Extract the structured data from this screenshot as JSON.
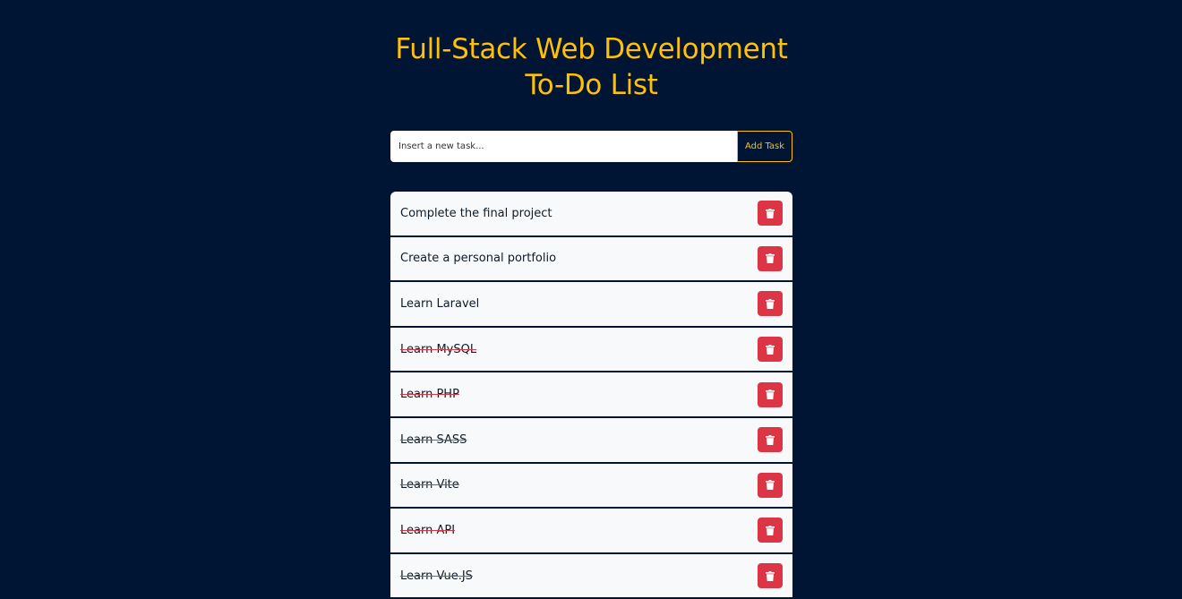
{
  "page": {
    "title_line1": "Full-Stack Web Development",
    "title_line2": "To-Do List"
  },
  "add_form": {
    "placeholder": "Insert a new task...",
    "button_label": "Add Task"
  },
  "tasks": [
    {
      "text": "Complete the final project",
      "done": false
    },
    {
      "text": "Create a personal portfolio",
      "done": false
    },
    {
      "text": "Learn Laravel",
      "done": false
    },
    {
      "text": "Learn MySQL",
      "done": true
    },
    {
      "text": "Learn PHP",
      "done": true
    },
    {
      "text": "Learn SASS",
      "done": true
    },
    {
      "text": "Learn Vite",
      "done": true
    },
    {
      "text": "Learn API",
      "done": true
    },
    {
      "text": "Learn Vue.JS",
      "done": true
    }
  ],
  "icons": {
    "delete": "trash-icon"
  },
  "colors": {
    "background": "#001533",
    "accent": "#ffc107",
    "danger": "#dc3545",
    "item_background": "#f8f9fa"
  }
}
